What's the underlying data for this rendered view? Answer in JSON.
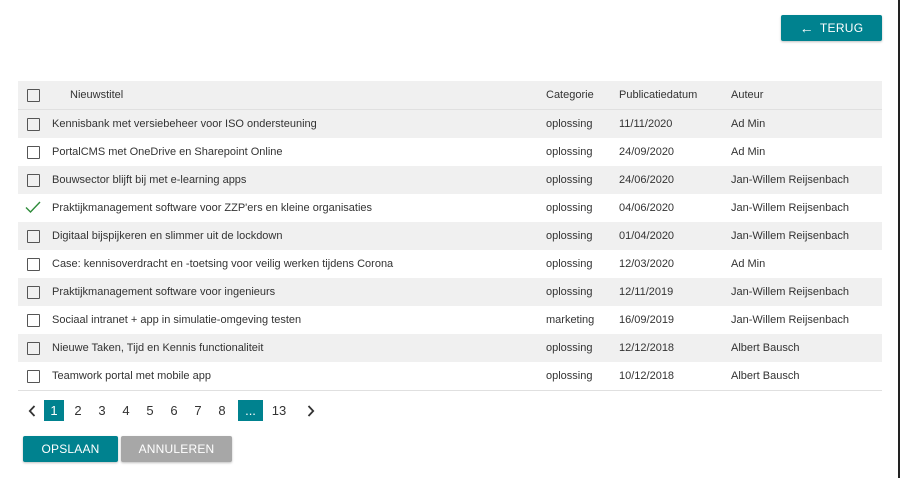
{
  "header": {
    "back_label": "TERUG",
    "back_icon": "arrow-left-icon"
  },
  "table": {
    "columns": [
      "Nieuwstitel",
      "Categorie",
      "Publicatiedatum",
      "Auteur"
    ],
    "rows": [
      {
        "title": "Kennisbank met versiebeheer voor ISO ondersteuning",
        "category": "oplossing",
        "date": "11/11/2020",
        "author": "Ad Min",
        "checked": false
      },
      {
        "title": "PortalCMS met OneDrive en Sharepoint Online",
        "category": "oplossing",
        "date": "24/09/2020",
        "author": "Ad Min",
        "checked": false
      },
      {
        "title": "Bouwsector blijft bij met e-learning apps",
        "category": "oplossing",
        "date": "24/06/2020",
        "author": "Jan-Willem Reijsenbach",
        "checked": false
      },
      {
        "title": "Praktijkmanagement software voor ZZP'ers en kleine organisaties",
        "category": "oplossing",
        "date": "04/06/2020",
        "author": "Jan-Willem Reijsenbach",
        "checked": true
      },
      {
        "title": "Digitaal bijspijkeren en slimmer uit de lockdown",
        "category": "oplossing",
        "date": "01/04/2020",
        "author": "Jan-Willem Reijsenbach",
        "checked": false
      },
      {
        "title": "Case: kennisoverdracht en -toetsing voor veilig werken tijdens Corona",
        "category": "oplossing",
        "date": "12/03/2020",
        "author": "Ad Min",
        "checked": false
      },
      {
        "title": "Praktijkmanagement software voor ingenieurs",
        "category": "oplossing",
        "date": "12/11/2019",
        "author": "Jan-Willem Reijsenbach",
        "checked": false
      },
      {
        "title": "Sociaal intranet + app in simulatie-omgeving testen",
        "category": "marketing",
        "date": "16/09/2019",
        "author": "Jan-Willem Reijsenbach",
        "checked": false
      },
      {
        "title": "Nieuwe Taken, Tijd en Kennis functionaliteit",
        "category": "oplossing",
        "date": "12/12/2018",
        "author": "Albert Bausch",
        "checked": false
      },
      {
        "title": "Teamwork portal met mobile app",
        "category": "oplossing",
        "date": "10/12/2018",
        "author": "Albert Bausch",
        "checked": false
      }
    ]
  },
  "pagination": {
    "prev_icon": "chevron-left-icon",
    "next_icon": "chevron-right-icon",
    "current": "1",
    "pages": [
      "2",
      "3",
      "4",
      "5",
      "6",
      "7",
      "8"
    ],
    "ellipsis": "...",
    "last": "13"
  },
  "footer": {
    "save_label": "OPSLAAN",
    "cancel_label": "ANNULEREN"
  },
  "colors": {
    "accent": "#00828f",
    "cancel": "#a7a7a7",
    "row_stripe": "#f0f0f0"
  }
}
